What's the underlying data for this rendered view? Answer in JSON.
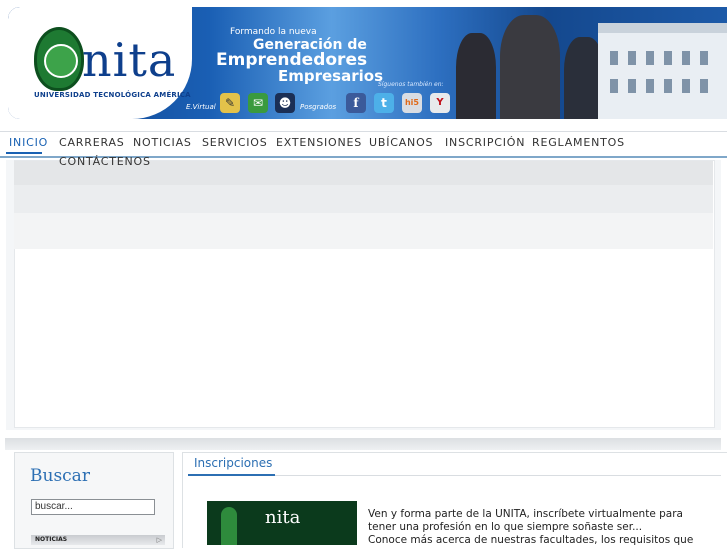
{
  "header": {
    "logo_word": "nita",
    "logo_initial": "U",
    "logo_subtitle": "UNIVERSIDAD TECNOLÓGICA AMÉRICA",
    "slogan_small": "Formando la nueva",
    "slogan_line1": "Generación de",
    "slogan_line2": "Emprendedores",
    "slogan_line3": "Empresarios",
    "social_text": "Síguenos también en:",
    "evirtual_label": "E.Virtual",
    "posgrados_label": "Posgrados",
    "icons": [
      "pencil-icon",
      "mail-icon",
      "people-icon",
      "facebook-icon",
      "twitter-icon",
      "hi5-icon",
      "youtube-icon"
    ]
  },
  "nav": {
    "items": [
      "INICIO",
      "CARRERAS",
      "NOTICIAS",
      "SERVICIOS",
      "EXTENSIONES",
      "UBÍCANOS",
      "INSCRIPCIÓN",
      "REGLAMENTOS",
      "CONTÁCTENOS"
    ],
    "active": "INICIO"
  },
  "sidebar": {
    "search_title": "Buscar",
    "search_value": "buscar...",
    "noticias_label": "NOTICIAS"
  },
  "main": {
    "section_title": "Inscripciones",
    "image_brand": "nita",
    "paragraph1": "Ven y forma parte de la UNITA, inscríbete virtualmente para tener una profesión en lo que siempre soñaste ser...",
    "paragraph2": "Conoce más acerca de nuestras facultades, los requisitos que"
  },
  "colors": {
    "brand_blue": "#1a62b3",
    "brand_green": "#1e7a32",
    "text": "#333333"
  }
}
